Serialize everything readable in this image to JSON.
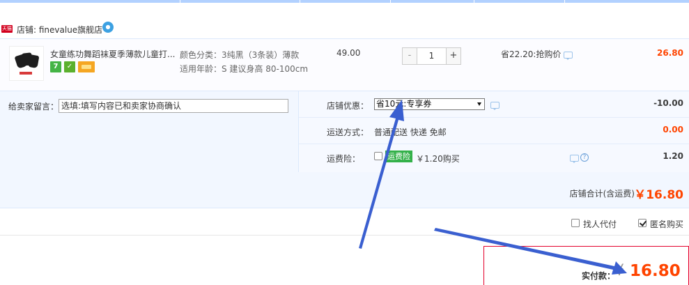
{
  "colors": {
    "accent_price": "#ff4400",
    "shop_badge": "#d2001e",
    "arrow": "#3a5fd0",
    "pay_border": "#e4002b"
  },
  "shop": {
    "badge": "天猫",
    "name": "店铺: finevalue旗舰店",
    "chat_icon": "wangwang-chat-icon"
  },
  "item": {
    "title": "女童练功舞蹈袜夏季薄款儿童打...",
    "sku_color": "颜色分类：3纯黑（3条装）薄款",
    "sku_age": "适用年龄：S 建议身高 80-100cm",
    "unit_price": "49.00",
    "qty_minus": "-",
    "qty_plus": "+",
    "quantity": "1",
    "promo": "省22.20:抢购价",
    "subtotal": "26.80",
    "service_icons": [
      "seven-day-return-icon",
      "guarantee-icon",
      "card-payment-icon"
    ]
  },
  "message": {
    "label": "给卖家留言：",
    "placeholder": "选填:填写内容已和卖家协商确认"
  },
  "shop_discount": {
    "label": "店铺优惠：",
    "selected": "省10元:专享券",
    "value": "-10.00"
  },
  "shipping": {
    "label": "运送方式：",
    "text": "普通配送 快递 免邮",
    "value": "0.00"
  },
  "insurance": {
    "label": "运费险：",
    "badge": "运费险",
    "price": "￥1.20购买",
    "value": "1.20"
  },
  "shop_total": {
    "label": "店铺合计(含运费)",
    "value": "￥16.80"
  },
  "options": {
    "proxy_pay": "找人代付",
    "anonymous": "匿名购买",
    "anonymous_checked": true
  },
  "pay": {
    "label": "实付款：",
    "currency": "¥",
    "value": "16.80"
  }
}
